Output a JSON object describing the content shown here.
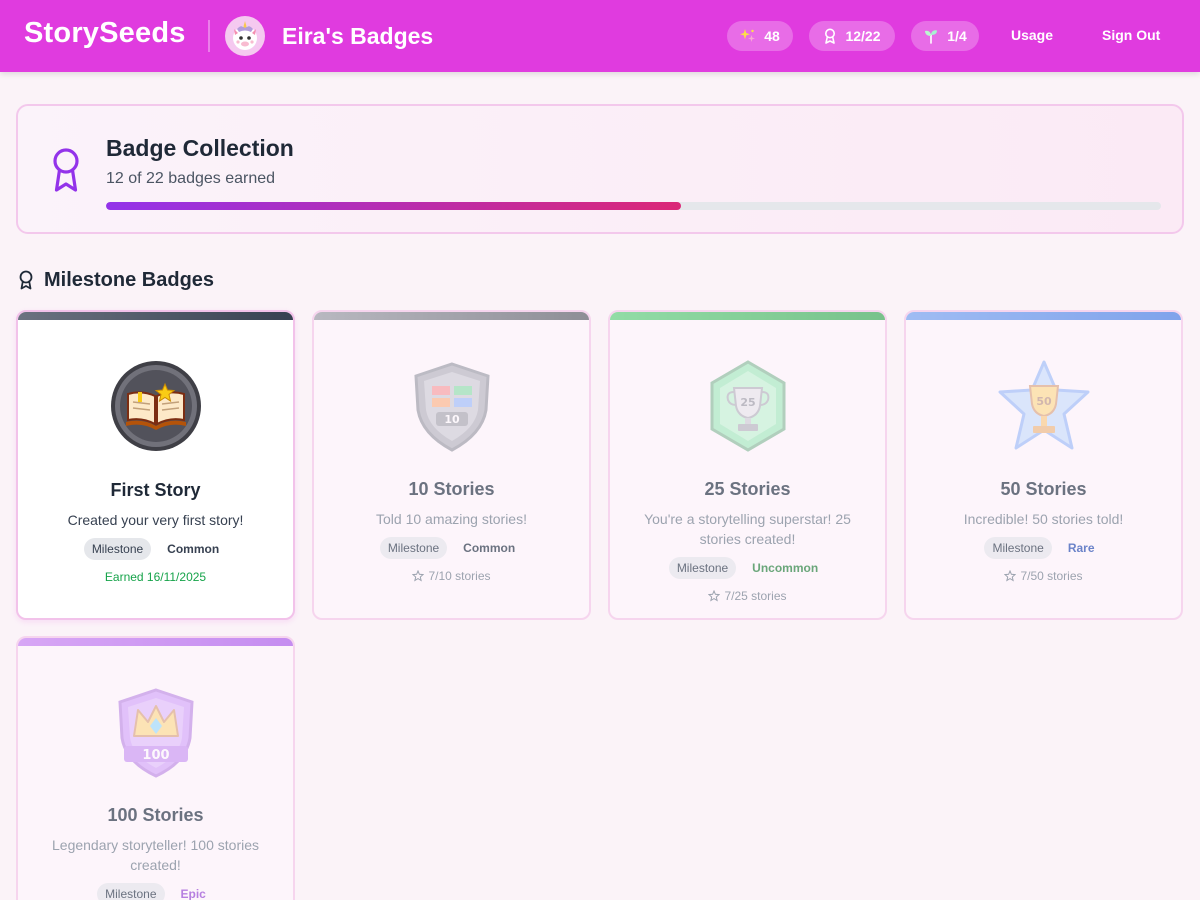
{
  "header": {
    "brand": "StorySeeds",
    "title": "Eira's Badges",
    "stats": [
      {
        "icon": "sparkles-icon",
        "value": "48"
      },
      {
        "icon": "award-icon",
        "value": "12/22"
      },
      {
        "icon": "sprout-icon",
        "value": "1/4"
      }
    ],
    "usage_label": "Usage",
    "signout_label": "Sign Out"
  },
  "collection": {
    "title": "Badge Collection",
    "subtitle": "12 of 22 badges earned",
    "progress": 0.545,
    "colors": {
      "start": "#9333ea",
      "end": "#db2777"
    }
  },
  "section": {
    "title": "Milestone Badges"
  },
  "badges": [
    {
      "name": "First Story",
      "description": "Created your very first story!",
      "category": "Milestone",
      "rarity": "Common",
      "rarity_color": "#374151",
      "earned": true,
      "footer": "Earned 16/11/2025",
      "bar_color": "#4b5563",
      "icon": "open-book-icon"
    },
    {
      "name": "10 Stories",
      "description": "Told 10 amazing stories!",
      "category": "Milestone",
      "rarity": "Common",
      "rarity_color": "#6b7280",
      "earned": false,
      "footer": "7/10 stories",
      "bar_color": "#9ca3af",
      "icon": "shield-icon",
      "emblem": "10"
    },
    {
      "name": "25 Stories",
      "description": "You're a storytelling superstar! 25 stories created!",
      "category": "Milestone",
      "rarity": "Uncommon",
      "rarity_color": "#6aa67a",
      "earned": false,
      "footer": "7/25 stories",
      "bar_color": "#86d19a",
      "icon": "trophy-icon",
      "emblem": "25"
    },
    {
      "name": "50 Stories",
      "description": "Incredible! 50 stories told!",
      "category": "Milestone",
      "rarity": "Rare",
      "rarity_color": "#6b83c9",
      "earned": false,
      "footer": "7/50 stories",
      "bar_color": "#8fb0ef",
      "icon": "star-trophy-icon",
      "emblem": "50"
    },
    {
      "name": "100 Stories",
      "description": "Legendary storyteller! 100 stories created!",
      "category": "Milestone",
      "rarity": "Epic",
      "rarity_color": "#b67fe0",
      "earned": false,
      "footer": "",
      "bar_color": "#d8a7f3",
      "icon": "crown-shield-icon",
      "emblem": "100"
    }
  ]
}
